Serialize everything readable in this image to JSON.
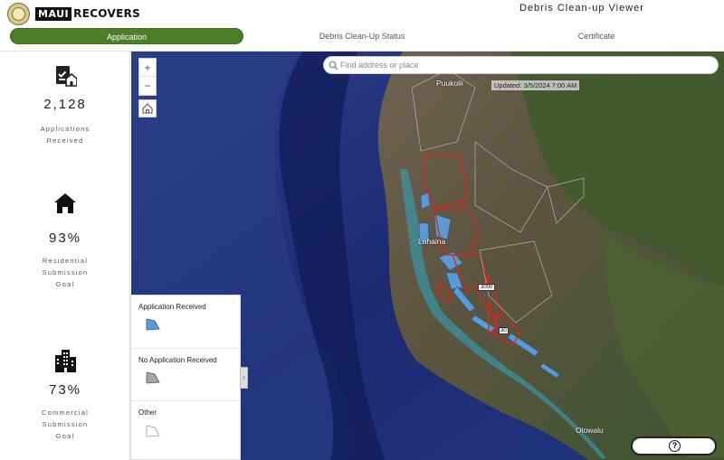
{
  "header": {
    "logo_box": "MAUI",
    "logo_rest": "RECOVERS",
    "app_title": "Debris Clean-up Viewer"
  },
  "tabs": [
    {
      "label": "Application",
      "active": true
    },
    {
      "label": "Debris Clean-Up Status",
      "active": false
    },
    {
      "label": "Certificate",
      "active": false
    }
  ],
  "stats": [
    {
      "icon": "application-document-icon",
      "value": "2,128",
      "label_lines": [
        "Applications",
        "Received"
      ]
    },
    {
      "icon": "house-icon",
      "value": "93%",
      "label_lines": [
        "Residential",
        "Submission",
        "Goal"
      ]
    },
    {
      "icon": "building-icon",
      "value": "73%",
      "label_lines": [
        "Commercial",
        "Submission",
        "Goal"
      ]
    }
  ],
  "map": {
    "search_placeholder": "Find address or place",
    "updated": "Updated: 3/5/2024 7:00 AM",
    "zoom_in": "+",
    "zoom_out": "−",
    "places": [
      "Puukolii",
      "Lahaina",
      "Olowalu"
    ],
    "road_shield": "30",
    "parcel_label": "3000"
  },
  "legend": {
    "items": [
      {
        "label": "Application Received",
        "color": "#5b9bd5"
      },
      {
        "label": "No Application Received",
        "color": "#a5a5a5"
      },
      {
        "label": "Other",
        "color": "#ffffff"
      }
    ],
    "collapse_glyph": "‹"
  },
  "help": {
    "glyph": "?"
  },
  "colors": {
    "accent": "#4c7e27",
    "fire_outline": "#e02020"
  }
}
